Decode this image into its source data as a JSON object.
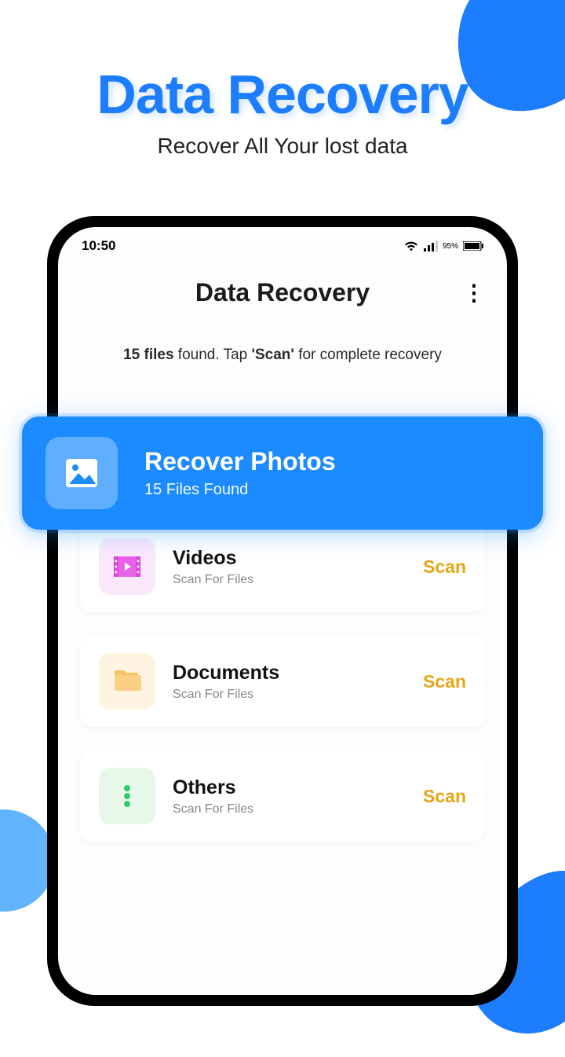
{
  "hero": {
    "title": "Data Recovery",
    "subtitle": "Recover All Your lost data"
  },
  "status": {
    "time": "10:50",
    "battery": "95%"
  },
  "app": {
    "title": "Data Recovery",
    "info_files": "15 files",
    "info_mid": " found. Tap ",
    "info_scan": "'Scan'",
    "info_end": " for complete recovery"
  },
  "highlight": {
    "title": "Recover Photos",
    "subtitle": "15 Files Found"
  },
  "cards": {
    "videos": {
      "title": "Videos",
      "sub": "Scan For Files",
      "action": "Scan"
    },
    "documents": {
      "title": "Documents",
      "sub": "Scan For Files",
      "action": "Scan"
    },
    "others": {
      "title": "Others",
      "sub": "Scan For Files",
      "action": "Scan"
    }
  }
}
